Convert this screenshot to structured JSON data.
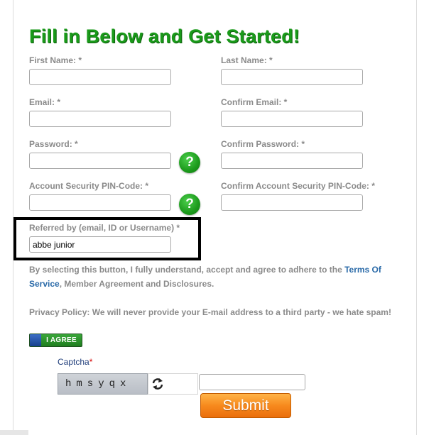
{
  "form": {
    "title": "Fill in Below and Get Started!",
    "first_name_label": "First Name: *",
    "last_name_label": "Last Name: *",
    "email_label": "Email: *",
    "confirm_email_label": "Confirm Email: *",
    "password_label": "Password: *",
    "confirm_password_label": "Confirm Password: *",
    "pin_label": "Account Security PIN-Code: *",
    "confirm_pin_label": "Confirm Account Security PIN-Code: *",
    "referred_label": "Referred by (email, ID or Username) *",
    "referred_value": "abbe junior",
    "help_symbol": "?",
    "first_name_value": "",
    "last_name_value": "",
    "email_value": "",
    "confirm_email_value": "",
    "password_value": "",
    "confirm_password_value": "",
    "pin_value": "",
    "confirm_pin_value": ""
  },
  "terms": {
    "text_before": "By selecting this button, I fully understand, accept and agree to adhere to the ",
    "link_part1": "Terms Of",
    "link_part2": "Service",
    "text_after": ", Member Agreement and Disclosures."
  },
  "privacy": {
    "text": "Privacy Policy: We will never provide your E-mail address to a third party - we hate spam!"
  },
  "agree_button": {
    "label": "I AGREE"
  },
  "captcha": {
    "label": "Captcha",
    "required_mark": "*",
    "image_text": "hmsyqx",
    "input_value": ""
  },
  "submit": {
    "label": "Submit"
  },
  "colors": {
    "title_green": "#1a9a1a",
    "label_gray": "#8a8a8a",
    "link_blue": "#2a6aa8",
    "submit_orange": "#f78a1d",
    "help_green": "#1c9a1c"
  },
  "icons": {
    "help": "question-mark-circle-icon",
    "refresh": "refresh-arrows-icon"
  }
}
